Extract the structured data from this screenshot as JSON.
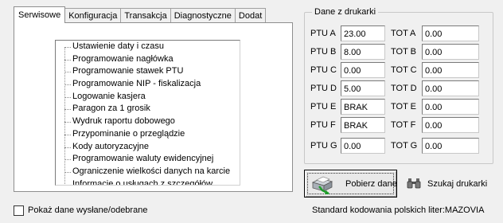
{
  "tabs": [
    "Serwisowe",
    "Konfiguracja",
    "Transakcja",
    "Diagnostyczne",
    "Dodat"
  ],
  "tree_items": [
    "Ustawienie daty i czasu",
    "Programowanie nagłówka",
    "Programowanie stawek PTU",
    "Programowanie NIP - fiskalizacja",
    "Logowanie kasjera",
    "Paragon za 1 grosik",
    "Wydruk raportu dobowego",
    "Przypominanie o przeglądzie",
    "Kody autoryzacyjne",
    "Programowanie waluty ewidencyjnej",
    "Ograniczenie wielkości danych na karcie",
    "Informacje o usługach z szczegółów"
  ],
  "printer_data": {
    "title": "Dane z drukarki",
    "ptu": [
      {
        "label": "PTU A",
        "value": "23.00"
      },
      {
        "label": "PTU B",
        "value": "8.00"
      },
      {
        "label": "PTU C",
        "value": "0.00"
      },
      {
        "label": "PTU D",
        "value": "5.00"
      },
      {
        "label": "PTU E",
        "value": "BRAK"
      },
      {
        "label": "PTU F",
        "value": "BRAK"
      },
      {
        "label": "PTU G",
        "value": "0.00"
      }
    ],
    "tot": [
      {
        "label": "TOT A",
        "value": "0.00"
      },
      {
        "label": "TOT B",
        "value": "0.00"
      },
      {
        "label": "TOT C",
        "value": "0.00"
      },
      {
        "label": "TOT D",
        "value": "0.00"
      },
      {
        "label": "TOT E",
        "value": "0.00"
      },
      {
        "label": "TOT F",
        "value": "0.00"
      },
      {
        "label": "TOT G",
        "value": "0.00"
      }
    ]
  },
  "buttons": {
    "fetch": "Pobierz dane",
    "find": "Szukaj drukarki"
  },
  "checkbox": {
    "label": "Pokaż dane wysłane/odebrane",
    "checked": false
  },
  "status": "Standard kodowania polskich liter:MAZOVIA"
}
